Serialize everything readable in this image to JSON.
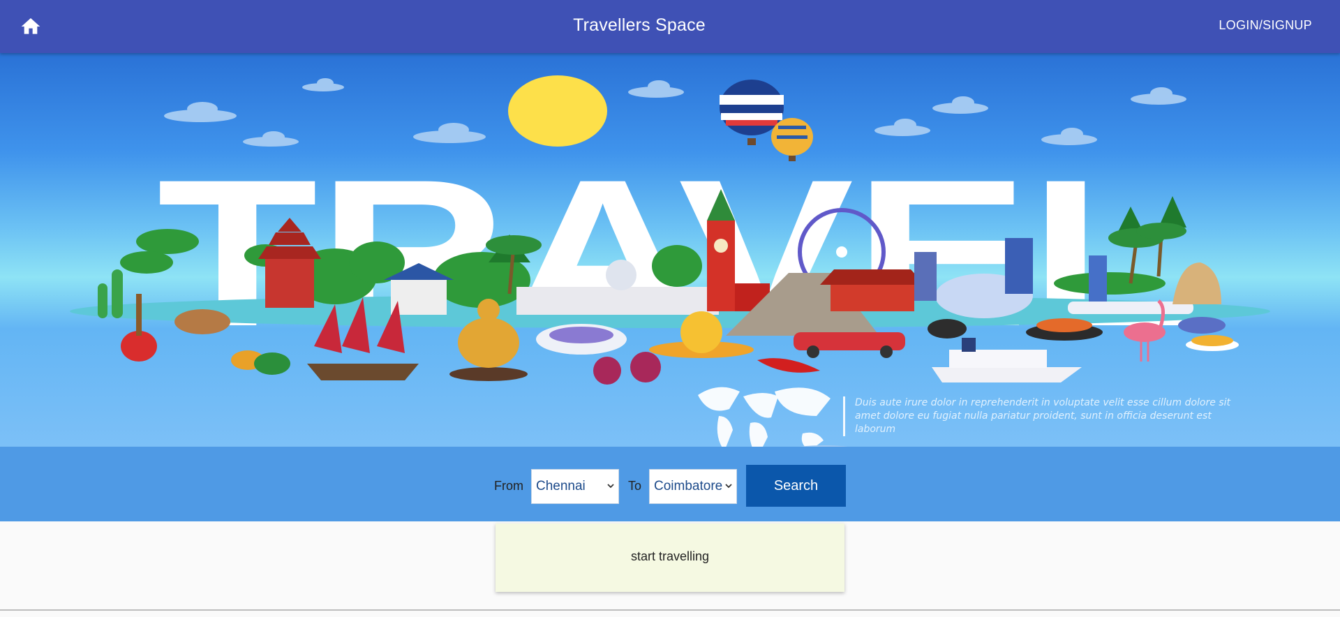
{
  "header": {
    "title": "Travellers Space",
    "home_icon": "home-icon",
    "login_label": "LOGIN/SIGNUP",
    "background": "#3f51b5"
  },
  "hero": {
    "big_word": "TRAVEL",
    "caption": "Duis aute irure dolor in reprehenderit in voluptate velit esse cillum dolore sit amet dolore eu fugiat nulla pariatur proident, sunt in officia deserunt est laborum"
  },
  "search": {
    "from_label": "From",
    "from_value": "Chennai",
    "to_label": "To",
    "to_value": "Coimbatore",
    "button_label": "Search",
    "button_color": "#0b57ab",
    "strip_color": "#4f9ae5"
  },
  "result": {
    "message": "start travelling",
    "card_color": "#f5f9e2"
  }
}
